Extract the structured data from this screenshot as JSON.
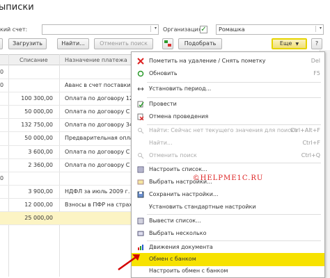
{
  "window": {
    "title": "ыписки"
  },
  "filters": {
    "account_label": "кий счет:",
    "account_value": "",
    "org_label": "Организация:",
    "org_checked": true,
    "org_value": "Ромашка"
  },
  "toolbar": {
    "load_label": "Загрузить",
    "find_label": "Найти...",
    "cancel_search_label": "Отменить поиск",
    "pick_label": "Подобрать",
    "more_label": "Еще",
    "help_label": "?"
  },
  "grid": {
    "headers": [
      "Списание",
      "Назначение платежа"
    ],
    "rows": [
      {
        "c1": "0",
        "amount": "",
        "purpose": ""
      },
      {
        "c1": "0",
        "amount": "",
        "purpose": "Аванс в счет поставки тов"
      },
      {
        "c1": "",
        "amount": "100 300,00",
        "purpose": "Оплата по договору 1245Й"
      },
      {
        "c1": "",
        "amount": "50 000,00",
        "purpose": "Оплата по договору С пос"
      },
      {
        "c1": "",
        "amount": "132 750,00",
        "purpose": "Оплата по договору 34/1"
      },
      {
        "c1": "",
        "amount": "50 000,00",
        "purpose": "Предварительная оплата Б"
      },
      {
        "c1": "",
        "amount": "3 600,00",
        "purpose": "Оплата по договору С пос"
      },
      {
        "c1": "",
        "amount": "2 360,00",
        "purpose": "Оплата по договору С пос"
      },
      {
        "c1": "0",
        "amount": "",
        "purpose": ""
      },
      {
        "c1": "",
        "amount": "3 900,00",
        "purpose": "НДФЛ за июль 2009 г."
      },
      {
        "c1": "",
        "amount": "12 000,00",
        "purpose": "Взносы в ПФР на страхов"
      },
      {
        "c1": "",
        "amount": "25 000,00",
        "purpose": ""
      }
    ]
  },
  "menu": {
    "items": [
      {
        "label": "Пометить на удаление / Снять пометку",
        "shortcut": "Del",
        "disabled": false
      },
      {
        "label": "Обновить",
        "shortcut": "F5",
        "disabled": false
      },
      {
        "label": "Установить период...",
        "shortcut": "",
        "disabled": false
      },
      {
        "label": "Провести",
        "shortcut": "",
        "disabled": false
      },
      {
        "label": "Отмена проведения",
        "shortcut": "",
        "disabled": false
      },
      {
        "label": "Найти: Сейчас нет текущего значения для поиска",
        "shortcut": "Ctrl+Alt+F",
        "disabled": true
      },
      {
        "label": "Найти...",
        "shortcut": "Ctrl+F",
        "disabled": true
      },
      {
        "label": "Отменить поиск",
        "shortcut": "Ctrl+Q",
        "disabled": true
      },
      {
        "label": "Настроить список...",
        "shortcut": "",
        "disabled": false
      },
      {
        "label": "Выбрать настройки...",
        "shortcut": "",
        "disabled": false
      },
      {
        "label": "Сохранить настройки...",
        "shortcut": "",
        "disabled": false
      },
      {
        "label": "Установить стандартные настройки",
        "shortcut": "",
        "disabled": false
      },
      {
        "label": "Вывести список...",
        "shortcut": "",
        "disabled": false
      },
      {
        "label": "Выбрать несколько",
        "shortcut": "",
        "disabled": false
      },
      {
        "label": "Движения документа",
        "shortcut": "",
        "disabled": false
      },
      {
        "label": "Обмен с банком",
        "shortcut": "",
        "disabled": false
      },
      {
        "label": "Настроить обмен с банком",
        "shortcut": "",
        "disabled": false
      }
    ],
    "watermark": "©HELPME1C.RU"
  },
  "colors": {
    "highlight": "#f7e200",
    "arrow": "#d40000",
    "selected_row": "#fcf4c4"
  }
}
